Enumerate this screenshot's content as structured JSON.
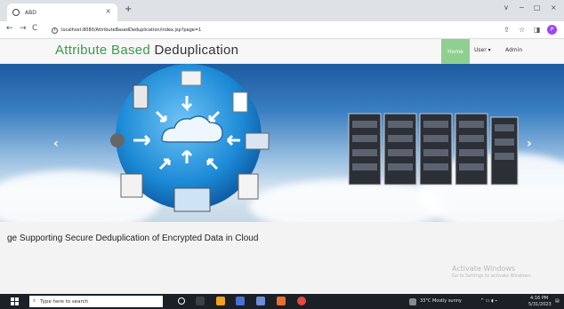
{
  "browser": {
    "tab_title": "ABD",
    "tab_close": "×",
    "new_tab": "+",
    "window_controls": [
      "∨",
      "−",
      "□",
      "×"
    ],
    "url": "localhost:8080/AttributeBasedDeduplication/index.jsp?page=1",
    "nav": {
      "back": "←",
      "forward": "→",
      "reload": "C"
    },
    "right_icons": [
      "share-icon",
      "star-icon",
      "sidebar-icon"
    ],
    "profile_initial": "P"
  },
  "site": {
    "brand_part1": "Attribute Based ",
    "brand_part2": "Deduplication",
    "menu": {
      "home": "Home",
      "user": "User ▾",
      "admin": "Admin"
    }
  },
  "hero": {
    "prev": "‹",
    "next": "›",
    "slides": 3,
    "active_slide": 3
  },
  "subtitle": "ge Supporting Secure Deduplication of Encrypted Data in Cloud",
  "watermark": {
    "line1": "Activate Windows",
    "line2": "Go to Settings to activate Windows."
  },
  "taskbar": {
    "search_placeholder": "Type here to search",
    "weather": "33°C  Mostly sunny",
    "time": "4:16 PM",
    "date": "5/31/2023",
    "colors": {
      "accent": "#3a9a4a",
      "home_bg": "#8fcf8f",
      "taskbar": "#1b1f26"
    }
  }
}
